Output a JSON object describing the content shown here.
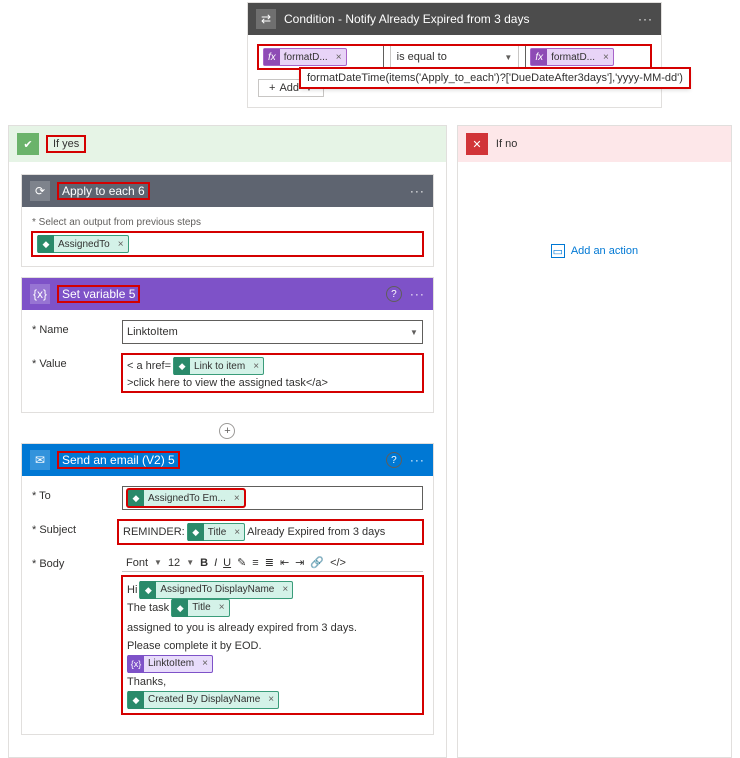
{
  "condition": {
    "title": "Condition - Notify Already Expired from 3 days",
    "left_pill": "formatD...",
    "operator": "is equal to",
    "right_pill": "formatD...",
    "tooltip": "formatDateTime(items('Apply_to_each')?['DueDateAfter3days'],'yyyy-MM-dd')",
    "add": "Add"
  },
  "yes": {
    "label": "If yes",
    "apply": {
      "title": "Apply to each 6",
      "note": "* Select an output from previous steps",
      "pill": "AssignedTo"
    },
    "setvar": {
      "title": "Set variable 5",
      "name_label": "* Name",
      "name_value": "LinktoItem",
      "value_label": "* Value",
      "value_prefix": "< a href=",
      "value_pill": "Link to item",
      "value_suffix": ">click here to view the assigned task</a>"
    },
    "email": {
      "title": "Send an email (V2) 5",
      "to_label": "* To",
      "to_pill": "AssignedTo Em...",
      "subject_label": "* Subject",
      "subject_prefix": "REMINDER:",
      "subject_pill": "Title",
      "subject_suffix": "Already Expired from 3 days",
      "body_label": "* Body",
      "font_label": "Font",
      "font_size": "12",
      "body_hi": "Hi",
      "body_pill1": "AssignedTo DisplayName",
      "body_line2a": "The task",
      "body_pill2": "Title",
      "body_line2b": "assigned to you is already expired from 3 days.",
      "body_line3": "Please complete it by EOD.",
      "body_varpill": "LinktoItem",
      "body_thanks": "Thanks,",
      "body_pill3": "Created By DisplayName"
    }
  },
  "no": {
    "label": "If no",
    "add_action": "Add an action"
  }
}
